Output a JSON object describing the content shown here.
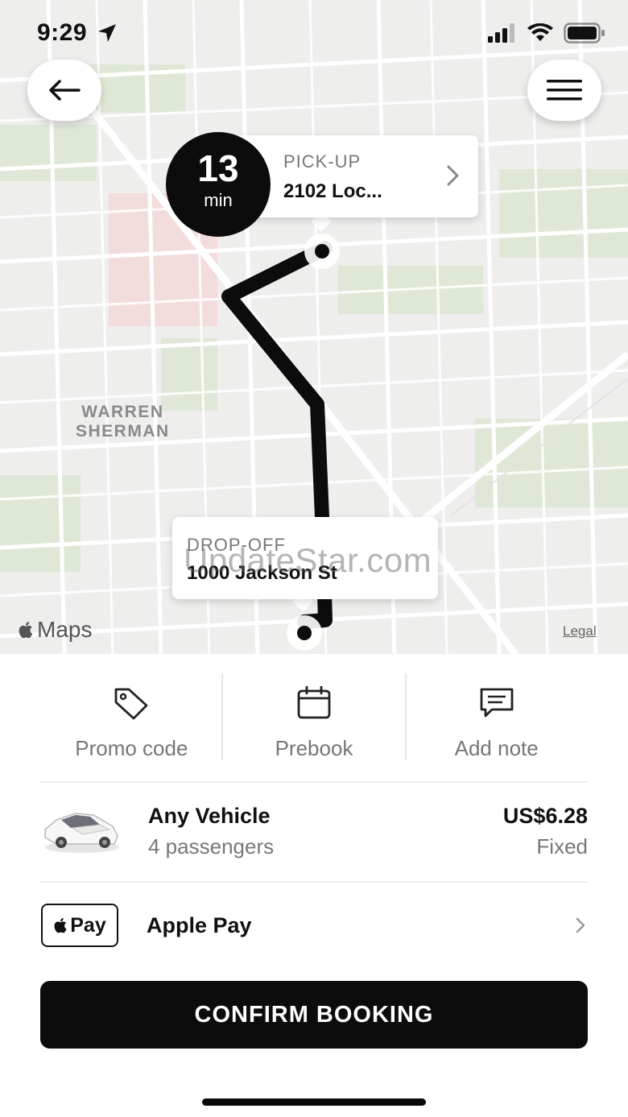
{
  "status_bar": {
    "time": "9:29",
    "icons": [
      "location-arrow-icon",
      "cellular-signal-icon",
      "wifi-icon",
      "battery-icon"
    ]
  },
  "map": {
    "district_line1": "WARREN",
    "district_line2": "SHERMAN",
    "brand": "Maps",
    "legal": "Legal",
    "watermark": "UpdateStar.com"
  },
  "eta": {
    "value": "13",
    "unit": "min"
  },
  "pickup": {
    "label": "PICK-UP",
    "address": "2102 Loc..."
  },
  "dropoff": {
    "label": "DROP-OFF",
    "address": "1000 Jackson St"
  },
  "actions": [
    {
      "label": "Promo code",
      "icon": "tag-icon"
    },
    {
      "label": "Prebook",
      "icon": "calendar-icon"
    },
    {
      "label": "Add note",
      "icon": "message-icon"
    }
  ],
  "vehicle": {
    "name": "Any Vehicle",
    "passengers": "4 passengers",
    "price": "US$6.28",
    "price_type": "Fixed"
  },
  "payment": {
    "badge": "Pay",
    "method": "Apple Pay"
  },
  "confirm_label": "CONFIRM BOOKING",
  "colors": {
    "primary": "#0c0c0c",
    "map_bg": "#eeeeec",
    "park": "#dfe8d6",
    "pink": "#f3dcdc",
    "muted_text": "#777777"
  }
}
